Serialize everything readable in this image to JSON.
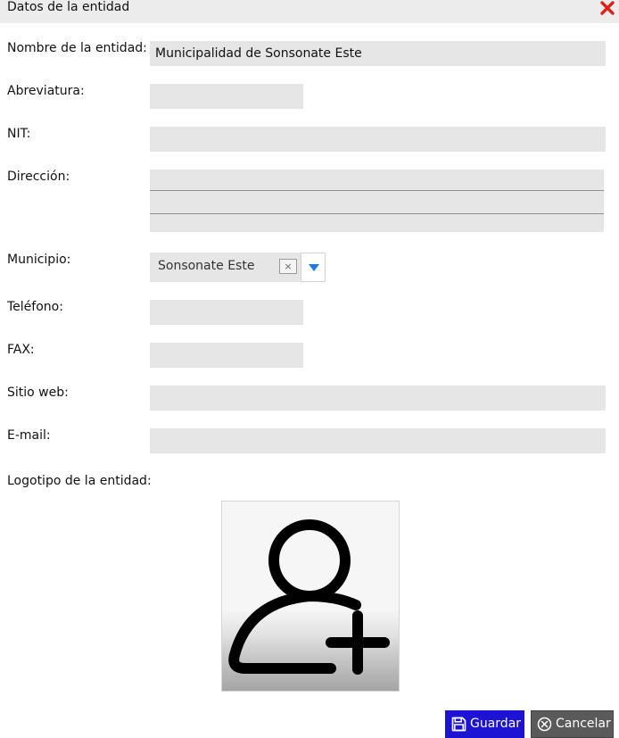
{
  "dialog": {
    "title": "Datos de la entidad",
    "close_icon": "close-icon",
    "accent_close_color": "#e0201a"
  },
  "form": {
    "nombre_label": "Nombre de la entidad:",
    "nombre_value": "Municipalidad de Sonsonate Este",
    "abreviatura_label": "Abreviatura:",
    "abreviatura_value": "",
    "nit_label": "NIT:",
    "nit_value": "",
    "direccion_label": "Dirección:",
    "direccion_value": "",
    "municipio_label": "Municipio:",
    "municipio_value": "Sonsonate Este",
    "municipio_clear": "×",
    "telefono_label": "Teléfono:",
    "telefono_value": "",
    "fax_label": "FAX:",
    "fax_value": "",
    "web_label": "Sitio web:",
    "web_value": "",
    "email_label": "E-mail:",
    "email_value": "",
    "logo_label": "Logotipo de la entidad:",
    "logo_icon": "add-user-icon"
  },
  "buttons": {
    "save_label": "Guardar",
    "save_icon": "floppy-disk-icon",
    "save_color": "#1d13d3",
    "cancel_label": "Cancelar",
    "cancel_icon": "circle-x-icon",
    "cancel_color": "#5a5a5a"
  }
}
